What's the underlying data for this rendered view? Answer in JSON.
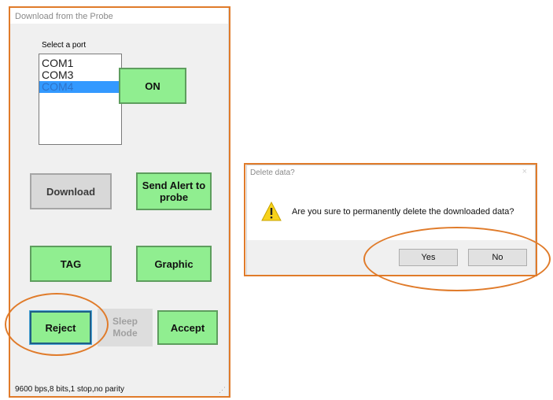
{
  "main_window": {
    "title": "Download from the  Probe",
    "port_label": "Select a port",
    "ports": [
      "COM1",
      "COM3",
      "COM4"
    ],
    "selected_port": "COM4",
    "buttons": {
      "on": "ON",
      "download": "Download",
      "send_alert": "Send Alert to probe",
      "tag": "TAG",
      "graphic": "Graphic",
      "reject": "Reject",
      "sleep_mode": "Sleep Mode",
      "accept": "Accept"
    },
    "status": "9600 bps,8 bits,1 stop,no parity"
  },
  "dialog": {
    "title": "Delete data?",
    "close": "×",
    "icon": "warning-icon",
    "message": "Are you sure to permanently delete the downloaded data?",
    "yes": "Yes",
    "no": "No"
  },
  "colors": {
    "button_green": "#90ee90",
    "selection_blue": "#3399ff",
    "annotation_orange": "#e07b2a"
  }
}
